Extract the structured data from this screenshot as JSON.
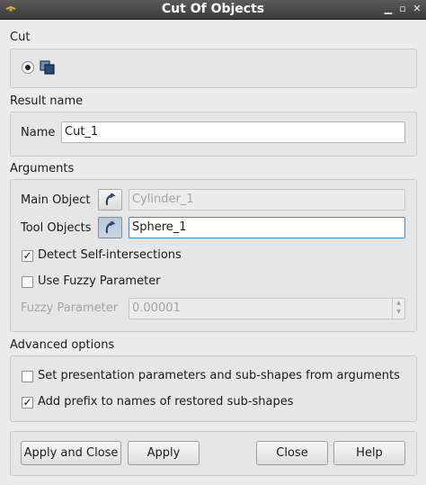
{
  "window": {
    "title": "Cut Of Objects"
  },
  "cut": {
    "section_label": "Cut"
  },
  "result": {
    "section_label": "Result name",
    "name_label": "Name",
    "name_value": "Cut_1"
  },
  "arguments": {
    "section_label": "Arguments",
    "main_object_label": "Main Object",
    "main_object_value": "Cylinder_1",
    "tool_objects_label": "Tool Objects",
    "tool_objects_value": "Sphere_1",
    "detect_self_intersections_label": "Detect Self-intersections",
    "detect_self_intersections_checked": true,
    "use_fuzzy_label": "Use Fuzzy Parameter",
    "use_fuzzy_checked": false,
    "fuzzy_label": "Fuzzy Parameter",
    "fuzzy_value": "0.00001"
  },
  "advanced": {
    "section_label": "Advanced options",
    "set_presentation_label": "Set presentation parameters and sub-shapes from arguments",
    "set_presentation_checked": false,
    "add_prefix_label": "Add prefix to names of restored sub-shapes",
    "add_prefix_checked": true
  },
  "buttons": {
    "apply_close": "Apply and Close",
    "apply": "Apply",
    "close": "Close",
    "help": "Help"
  },
  "colors": {
    "titlebar": "#484848",
    "focus_border": "#3a8ad6",
    "selection_icon": "#2b4a73"
  }
}
